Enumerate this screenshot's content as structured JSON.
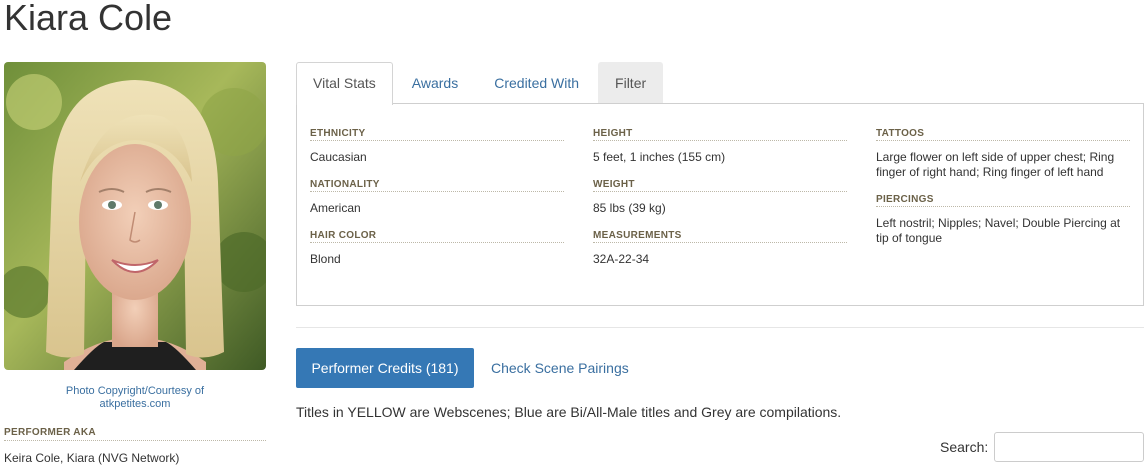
{
  "performer": {
    "name": "Kiara Cole",
    "photo_credit_line1": "Photo Copyright/Courtesy of",
    "photo_credit_line2": "atkpetites.com",
    "aka_label": "PERFORMER AKA",
    "aka_value": "Keira Cole, Kiara (NVG Network)"
  },
  "tabs": [
    {
      "label": "Vital Stats",
      "active": true
    },
    {
      "label": "Awards",
      "active": false
    },
    {
      "label": "Credited With",
      "active": false
    },
    {
      "label": "Filter",
      "active": false
    }
  ],
  "vital_stats": {
    "ethnicity": {
      "label": "ETHNICITY",
      "value": "Caucasian"
    },
    "nationality": {
      "label": "NATIONALITY",
      "value": "American"
    },
    "hair_color": {
      "label": "HAIR COLOR",
      "value": "Blond"
    },
    "height": {
      "label": "HEIGHT",
      "value": "5 feet, 1 inches (155 cm)"
    },
    "weight": {
      "label": "WEIGHT",
      "value": "85 lbs (39 kg)"
    },
    "measurements": {
      "label": "MEASUREMENTS",
      "value": "32A-22-34"
    },
    "tattoos": {
      "label": "TATTOOS",
      "value": "Large flower on left side of upper chest; Ring finger of right hand; Ring finger of left hand"
    },
    "piercings": {
      "label": "PIERCINGS",
      "value": "Left nostril; Nipples; Navel; Double Piercing at tip of tongue"
    }
  },
  "credits": {
    "button_label": "Performer Credits (181)",
    "pairings_link": "Check Scene Pairings",
    "note": "Titles in YELLOW are Webscenes; Blue are Bi/All-Male titles and Grey are compilations."
  },
  "search": {
    "label": "Search:",
    "placeholder": ""
  },
  "colors": {
    "accent": "#3578b5",
    "link": "#3a6fa0",
    "label": "#6b6148"
  }
}
